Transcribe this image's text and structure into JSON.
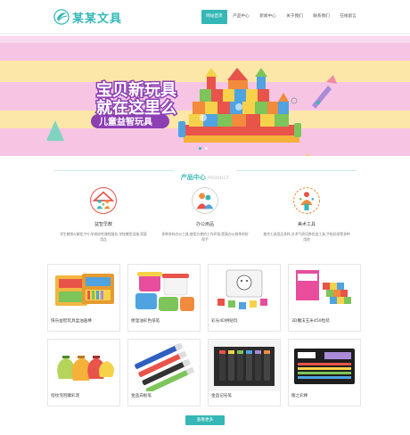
{
  "brand": {
    "name": "某某文具",
    "color": "#35b8b5"
  },
  "nav": {
    "items": [
      {
        "label": "网站首页",
        "active": true
      },
      {
        "label": "产品中心",
        "active": false
      },
      {
        "label": "新闻中心",
        "active": false
      },
      {
        "label": "关于我们",
        "active": false
      },
      {
        "label": "联系我们",
        "active": false
      },
      {
        "label": "在线留言",
        "active": false
      }
    ]
  },
  "banner": {
    "line1": "宝贝新玩具",
    "line2": "就在这里么",
    "line3": "儿童益智玩具",
    "slides": 2,
    "active_slide": 1
  },
  "section": {
    "title": "产品中心",
    "subtitle": "PRODUCT"
  },
  "categories": [
    {
      "name": "益智早教",
      "icon": "house-family-icon",
      "desc": "学生教育&课程,中小学校研究课程服务,学校教室设施,家庭用品"
    },
    {
      "name": "办公用品",
      "icon": "people-icon",
      "desc": "多种多样办公工具,使用方便的工作环境,提高办公效率的好帮手"
    },
    {
      "name": "美术工具",
      "icon": "artist-icon",
      "desc": "美术工具用品多样,艺术气质培养优选工具,手绘彩绘等多种用途"
    }
  ],
  "products": [
    {
      "title": "快乐益智玩具盒油画棒",
      "icon": "crayon-box-icon"
    },
    {
      "title": "便温油彩色纸笔",
      "icon": "clay-buckets-icon"
    },
    {
      "title": "彩光4D拼贴玩",
      "icon": "puzzle-tray-icon"
    },
    {
      "title": "3D魔法玉米450粒装",
      "icon": "block-set-icon"
    },
    {
      "title": "指纹泡泡罐彩泥",
      "icon": "paint-sacks-icon"
    },
    {
      "title": "金品白板笔",
      "icon": "whiteboard-markers-icon"
    },
    {
      "title": "金品记号笔",
      "icon": "marker-set-icon"
    },
    {
      "title": "版之彩棒",
      "icon": "pen-case-icon"
    }
  ],
  "more_label": "查看更多"
}
